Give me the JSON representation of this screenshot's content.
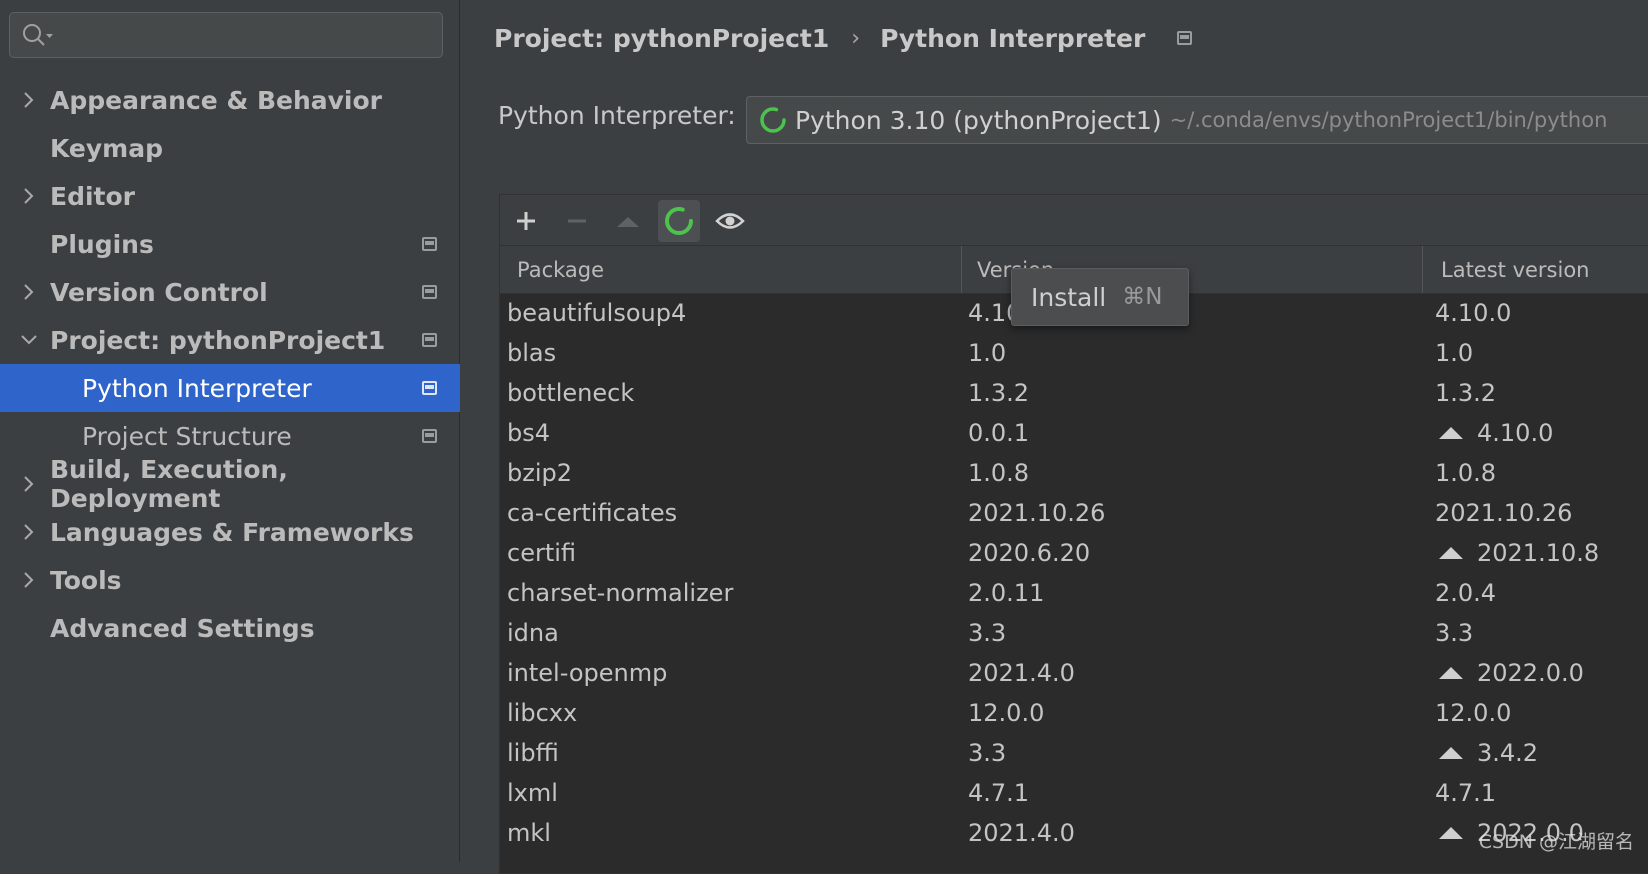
{
  "sidebar": {
    "search": {
      "placeholder": ""
    },
    "items": [
      {
        "label": "Appearance & Behavior",
        "expandable": true,
        "expanded": false
      },
      {
        "label": "Keymap",
        "expandable": false
      },
      {
        "label": "Editor",
        "expandable": true,
        "expanded": false
      },
      {
        "label": "Plugins",
        "expandable": false,
        "project_icon": true
      },
      {
        "label": "Version Control",
        "expandable": true,
        "expanded": false,
        "project_icon": true
      },
      {
        "label": "Project: pythonProject1",
        "expandable": true,
        "expanded": true,
        "project_icon": true
      },
      {
        "label": "Python Interpreter",
        "selected": true,
        "sub": true,
        "project_icon": true
      },
      {
        "label": "Project Structure",
        "sub": true,
        "project_icon": true
      },
      {
        "label": "Build, Execution, Deployment",
        "expandable": true,
        "expanded": false
      },
      {
        "label": "Languages & Frameworks",
        "expandable": true,
        "expanded": false
      },
      {
        "label": "Tools",
        "expandable": true,
        "expanded": false
      },
      {
        "label": "Advanced Settings",
        "expandable": false
      }
    ]
  },
  "breadcrumb": {
    "parent": "Project: pythonProject1",
    "separator": "›",
    "current": "Python Interpreter"
  },
  "interpreter": {
    "label": "Python Interpreter:",
    "name": "Python 3.10 (pythonProject1)",
    "path": "~/.conda/envs/pythonProject1/bin/python"
  },
  "toolbar": {
    "add_icon": "plus-icon",
    "remove_icon": "minus-icon",
    "upgrade_icon": "upgrade-arrow-icon",
    "refresh_icon": "loading-spinner-icon",
    "show_early_releases_icon": "eye-icon"
  },
  "table": {
    "columns": [
      "Package",
      "Version",
      "Latest version"
    ],
    "rows": [
      {
        "package": "beautifulsoup4",
        "version": "4.10.0",
        "latest": "4.10.0",
        "upgrade": false
      },
      {
        "package": "blas",
        "version": "1.0",
        "latest": "1.0",
        "upgrade": false
      },
      {
        "package": "bottleneck",
        "version": "1.3.2",
        "latest": "1.3.2",
        "upgrade": false
      },
      {
        "package": "bs4",
        "version": "0.0.1",
        "latest": "4.10.0",
        "upgrade": true
      },
      {
        "package": "bzip2",
        "version": "1.0.8",
        "latest": "1.0.8",
        "upgrade": false
      },
      {
        "package": "ca-certificates",
        "version": "2021.10.26",
        "latest": "2021.10.26",
        "upgrade": false
      },
      {
        "package": "certifi",
        "version": "2020.6.20",
        "latest": "2021.10.8",
        "upgrade": true
      },
      {
        "package": "charset-normalizer",
        "version": "2.0.11",
        "latest": "2.0.4",
        "upgrade": false
      },
      {
        "package": "idna",
        "version": "3.3",
        "latest": "3.3",
        "upgrade": false
      },
      {
        "package": "intel-openmp",
        "version": "2021.4.0",
        "latest": "2022.0.0",
        "upgrade": true
      },
      {
        "package": "libcxx",
        "version": "12.0.0",
        "latest": "12.0.0",
        "upgrade": false
      },
      {
        "package": "libffi",
        "version": "3.3",
        "latest": "3.4.2",
        "upgrade": true
      },
      {
        "package": "lxml",
        "version": "4.7.1",
        "latest": "4.7.1",
        "upgrade": false
      },
      {
        "package": "mkl",
        "version": "2021.4.0",
        "latest": "2022.0.0",
        "upgrade": true
      }
    ]
  },
  "tooltip": {
    "label": "Install",
    "shortcut": "⌘N"
  },
  "watermark": "CSDN @江湖留名",
  "colors": {
    "selection": "#2f65ca",
    "background": "#3c3f41",
    "table_bg": "#2b2b2b",
    "spinner": "#4ec24e"
  }
}
